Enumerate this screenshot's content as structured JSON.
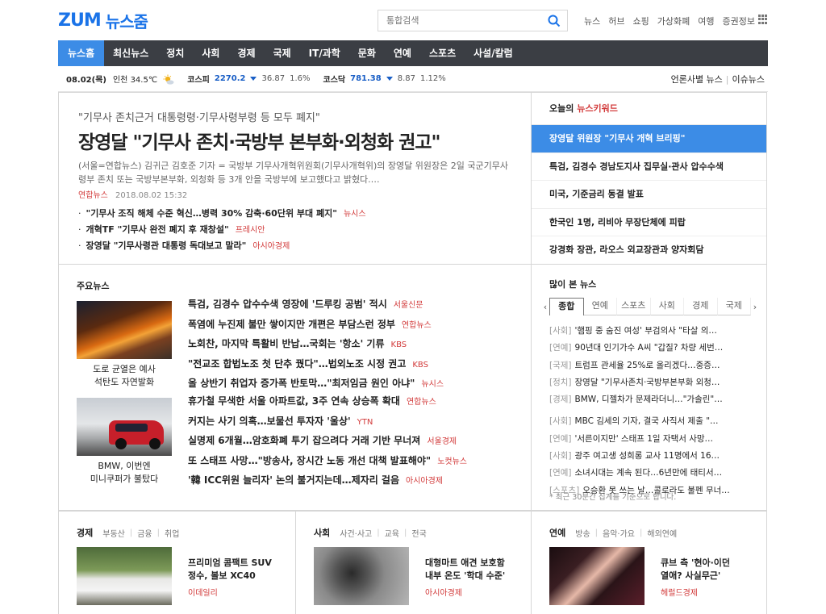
{
  "header": {
    "logo_zum": "ZUM",
    "logo_news": "뉴스줌",
    "search_placeholder": "통합검색",
    "links": [
      "뉴스",
      "허브",
      "쇼핑",
      "가상화폐",
      "여행",
      "증권정보"
    ]
  },
  "gnb": {
    "tabs": [
      "뉴스홈",
      "최신뉴스",
      "정치",
      "사회",
      "경제",
      "국제",
      "IT/과학",
      "문화",
      "연예",
      "스포츠",
      "사설/칼럼"
    ],
    "active_index": 0
  },
  "ticker": {
    "date": "08.02(목)",
    "weather": "인천 34.5℃",
    "kospi": {
      "name": "코스피",
      "value": "2270.2",
      "change": "36.87",
      "pct": "1.6%"
    },
    "kosdaq": {
      "name": "코스닥",
      "value": "781.38",
      "change": "8.87",
      "pct": "1.12%"
    },
    "right_1": "언론사별 뉴스",
    "right_sep": "|",
    "right_2": "이슈뉴스"
  },
  "headline": {
    "sub": "\"기무사 존치근거 대통령령·기무사령부령 등 모두 폐지\"",
    "title": "장영달 \"기무사 존치·국방부 본부화·외청화 권고\"",
    "body": "(서울=연합뉴스) 김귀근 김호준 기자 = 국방부 기무사개혁위원회(기무사개혁위)의 장영달 위원장은 2일 국군기무사령부 존치 또는 국방부본부화, 외청화 등 3개 안을 국방부에 보고했다고 밝혔다.…",
    "source": "연합뉴스",
    "datetime": "2018.08.02 15:32",
    "related": [
      {
        "title": "\"기무사 조직 해체 수준 혁신…병력 30% 감축·60단위 부대 폐지\"",
        "source": "뉴시스"
      },
      {
        "title": "개혁TF \"기무사 완전 폐지 후 재창설\"",
        "source": "프레시안"
      },
      {
        "title": "장영달 \"기무사령관 대통령 독대보고 말라\"",
        "source": "아시아경제"
      }
    ]
  },
  "keywords": {
    "title_prefix": "오늘의",
    "title_red": "뉴스키워드",
    "items": [
      "장영달 위원장 \"기무사 개혁 브리핑\"",
      "특검, 김경수 경남도지사 집무실·관사 압수수색",
      "미국, 기준금리 동결 발표",
      "한국인 1명, 리비아 무장단체에 피랍",
      "강경화 장관, 라오스 외교장관과 양자회담"
    ],
    "active_index": 0
  },
  "mainnews": {
    "title": "주요뉴스",
    "thumb1_caption_1": "도로 균열은 예사",
    "thumb1_caption_2": "석탄도 자연발화",
    "thumb2_caption_1": "BMW, 이번엔",
    "thumb2_caption_2": "미니쿠퍼가 불탔다",
    "group1": [
      {
        "title": "특검, 김경수 압수수색 영장에 '드루킹 공범' 적시",
        "source": "서울신문"
      },
      {
        "title": "폭염에 누진제 불만 쌓이지만 개편은 부담스런 정부",
        "source": "연합뉴스"
      },
      {
        "title": "노회찬, 마지막 특활비 반납…국회는 '항소' 기류",
        "source": "KBS"
      },
      {
        "title": "\"전교조 합법노조 첫 단추 꿨다\"…법외노조 시정 권고",
        "source": "KBS"
      },
      {
        "title": "올 상반기 취업자 증가폭 반토막…\"최저임금 원인 아냐\"",
        "source": "뉴시스"
      }
    ],
    "group2": [
      {
        "title": "휴가철 무색한 서울 아파트값, 3주 연속 상승폭 확대",
        "source": "연합뉴스"
      },
      {
        "title": "커지는 사기 의혹…보물선 투자자 '울상'",
        "source": "YTN"
      },
      {
        "title": "실명제 6개월…암호화폐 투기 잡으려다 거래 기반 무너져",
        "source": "서울경제"
      },
      {
        "title": "또 스태프 사망…\"방송사, 장시간 노동 개선 대책 발표해야\"",
        "source": "노컷뉴스"
      },
      {
        "title": "'韓 ICC위원 늘리자' 논의 불거지는데…제자리 걸음",
        "source": "아시아경제"
      }
    ]
  },
  "popular": {
    "title": "많이 본 뉴스",
    "tabs": [
      "종합",
      "연예",
      "스포츠",
      "사회",
      "경제",
      "국제"
    ],
    "active_index": 0,
    "group1": [
      {
        "cat": "[사회]",
        "title": "'햄핑 중 숨진 여성' 부검의사 \"타살 의…"
      },
      {
        "cat": "[연예]",
        "title": "90년대 인기가수 A씨 \"갑질? 차량 세번…"
      },
      {
        "cat": "[국제]",
        "title": "트럼프 관세율 25%로 올리겠다…중증…"
      },
      {
        "cat": "[정치]",
        "title": "장영달 \"기무사존치·국방부본부화 외청…"
      },
      {
        "cat": "[경제]",
        "title": "BMW, 디젤차가 문제라더니…\"가솔린\"…"
      }
    ],
    "group2": [
      {
        "cat": "[사회]",
        "title": "MBC 김세의 기자, 결국 사직서 제출 \"…"
      },
      {
        "cat": "[연예]",
        "title": "'서른이지만' 스태프 1일 자택서 사망…"
      },
      {
        "cat": "[사회]",
        "title": "광주 여고생 성희롱 교사 11명에서 16…"
      },
      {
        "cat": "[연예]",
        "title": "소녀시대는 계속 된다…6년만에 태티서…"
      },
      {
        "cat": "[스포츠]",
        "title": "오승환 못 쓰는 날…콜로라도 불펜 무너…"
      }
    ],
    "note": "* 최근 30분간 집계를 기준으로 합니다."
  },
  "bottom": {
    "economy": {
      "head": "경제",
      "subs": [
        "부동산",
        "금융",
        "취업"
      ],
      "title_1": "프리미엄 콤팩트 SUV",
      "title_2": "정수, 볼보 XC40",
      "source": "이데일리"
    },
    "society": {
      "head": "사회",
      "subs": [
        "사건·사고",
        "교육",
        "전국"
      ],
      "title_1": "대형마트 애견 보호함",
      "title_2": "내부 온도 '학대 수준'",
      "source": "아시아경제"
    },
    "entertainment": {
      "head": "연예",
      "subs": [
        "방송",
        "음악·가요",
        "해외연예"
      ],
      "title_1": "큐브 측 '현아·이던",
      "title_2": "열애? 사실무근'",
      "source": "헤럴드경제"
    }
  },
  "colors": {
    "brand": "#1a73e8",
    "accent": "#3c8ce6",
    "nav": "#3b3e44",
    "source_red": "#d23a3a",
    "stock_blue": "#1a5fc6"
  }
}
